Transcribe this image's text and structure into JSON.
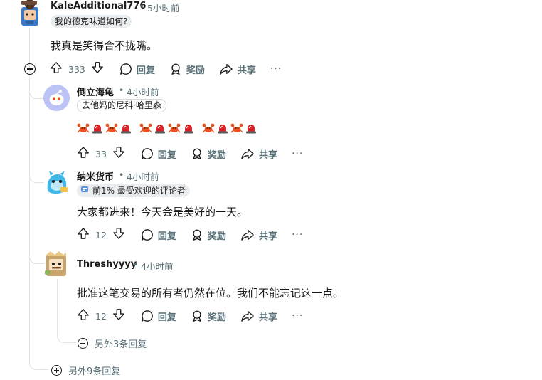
{
  "comments": [
    {
      "author": "KaleAdditional776",
      "time": "5小时前",
      "flair": "我的德克味道如何?",
      "body": "我真是笑得合不拢嘴。",
      "votes": "333"
    },
    {
      "author": "倒立海龟",
      "time": "4小时前",
      "flair": "去他妈的尼科·哈里森",
      "body_emoji": [
        "crab",
        "siren",
        "crab",
        "siren",
        "crab",
        "siren",
        "crab",
        "siren",
        "crab",
        "siren",
        "crab",
        "siren"
      ],
      "votes": "33"
    },
    {
      "author": "纳米货币",
      "time": "4小时前",
      "flair": "前1% 最受欢迎的评论者",
      "body": "大家都进来！今天会是美好的一天。",
      "votes": "12"
    },
    {
      "author": "Threshyyyy",
      "time": "4小时前",
      "body": "批准这笔交易的所有者仍然在位。我们不能忘记这一点。",
      "votes": "12"
    }
  ],
  "actions": {
    "reply": "回复",
    "award": "奖励",
    "share": "共享",
    "more": "···",
    "separator": "•"
  },
  "more_replies": {
    "nested": "另外3条回复",
    "top": "另外9条回复"
  },
  "icons": [
    "upvote-icon",
    "downvote-icon",
    "comment-icon",
    "award-icon",
    "share-icon",
    "collapse-icon",
    "plus-circle-icon",
    "crab-emoji",
    "siren-emoji",
    "top-commenter-icon"
  ],
  "colors": {
    "meta": "#576f76",
    "thread": "#dfe3e6",
    "crab": "#e8521f",
    "siren": "#d8232a"
  }
}
